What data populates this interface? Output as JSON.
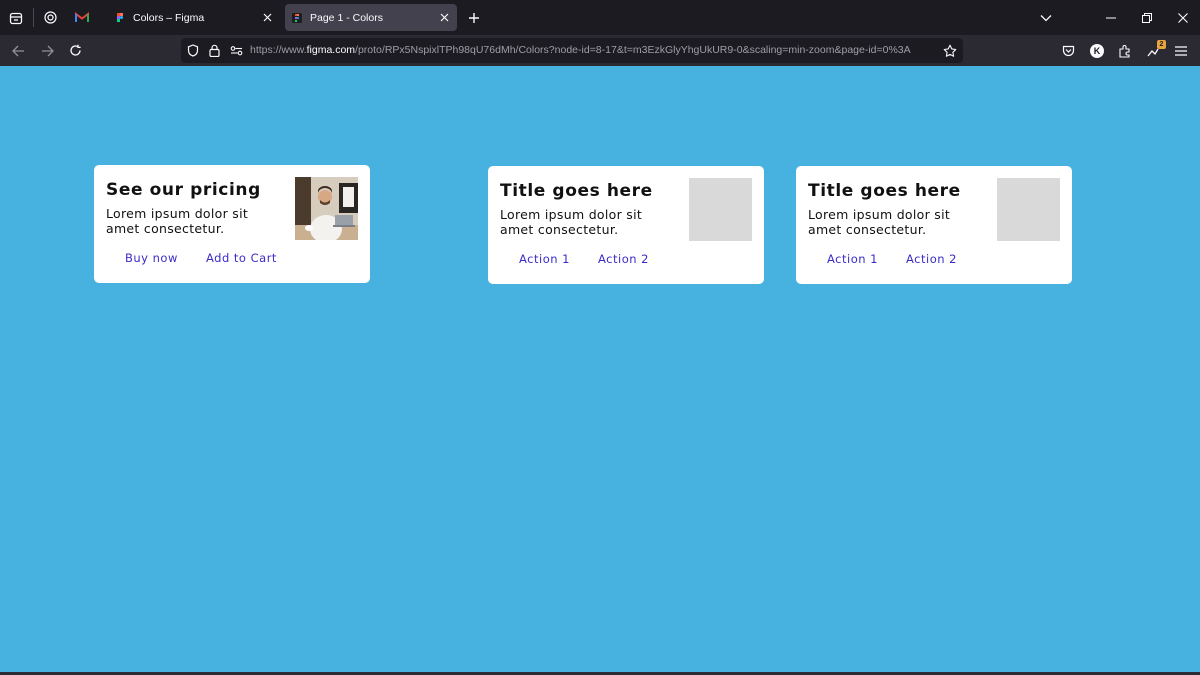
{
  "browser": {
    "tabs": [
      {
        "title": "Colors – Figma",
        "active": false
      },
      {
        "title": "Page 1 - Colors",
        "active": true
      }
    ],
    "url_prefix": "https://www.",
    "url_domain": "figma.com",
    "url_rest": "/proto/RPx5NspixlTPh98qU76dMh/Colors?node-id=8-17&t=m3EzkGlyYhgUkUR9-0&scaling=min-zoom&page-id=0%3A",
    "profile_initial": "K",
    "extension_badge": "2"
  },
  "canvas": {
    "background": "#47b2e0"
  },
  "cards": [
    {
      "title": "See our pricing",
      "body": "Lorem ipsum dolor sit amet consectetur.",
      "action1": "Buy now",
      "action2": "Add to Cart"
    },
    {
      "title": "Title goes here",
      "body": "Lorem ipsum dolor sit amet consectetur.",
      "action1": "Action 1",
      "action2": "Action 2"
    },
    {
      "title": "Title goes here",
      "body": "Lorem ipsum dolor sit amet consectetur.",
      "action1": "Action 1",
      "action2": "Action 2"
    }
  ],
  "colors": {
    "action_text": "#3a2bc9",
    "placeholder": "#d9d9d9"
  }
}
